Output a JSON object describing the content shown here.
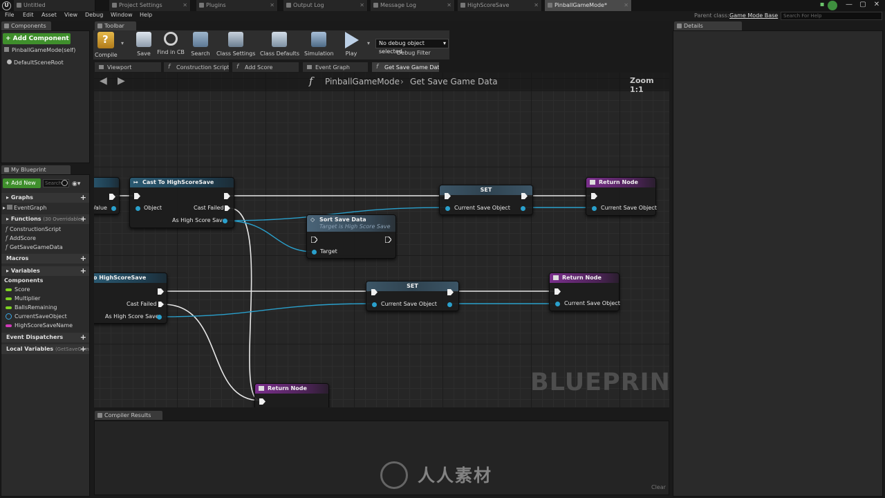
{
  "doc_tabs": [
    {
      "label": "Untitled",
      "active": false
    },
    {
      "label": "Project Settings",
      "active": false
    },
    {
      "label": "Plugins",
      "active": false
    },
    {
      "label": "Output Log",
      "active": false
    },
    {
      "label": "Message Log",
      "active": false
    },
    {
      "label": "HighScoreSave",
      "active": false
    },
    {
      "label": "PinballGameMode*",
      "active": true
    }
  ],
  "menu": [
    "File",
    "Edit",
    "Asset",
    "View",
    "Debug",
    "Window",
    "Help"
  ],
  "parent_class": {
    "label": "Parent class:",
    "value": "Game Mode Base"
  },
  "help_search_placeholder": "Search For Help",
  "components_panel": {
    "tab": "Components",
    "add_button": "+ Add Component",
    "items": [
      "PinballGameMode(self)",
      "DefaultSceneRoot"
    ]
  },
  "toolbar": {
    "tab": "Toolbar",
    "buttons": [
      "Compile",
      "Save",
      "Find in CB",
      "Search",
      "Class Settings",
      "Class Defaults",
      "Simulation",
      "Play"
    ],
    "debug_select": "No debug object selected",
    "debug_filter_label": "Debug Filter"
  },
  "editor_tabs": [
    "Viewport",
    "Construction Script",
    "Add Score",
    "Event Graph",
    "Get Save Game Dat"
  ],
  "graph": {
    "breadcrumb_root": "PinballGameMode",
    "breadcrumb_func": "Get Save Game Data",
    "zoom": "Zoom 1:1",
    "watermark": "BLUEPRINT"
  },
  "nodes": {
    "partial_top": {
      "pin_label": "Value"
    },
    "cast_top": {
      "title": "Cast To HighScoreSave",
      "pins": [
        "Object",
        "Cast Failed",
        "As High Score Save"
      ]
    },
    "sort_save": {
      "title": "Sort Save Data",
      "subtitle": "Target is High Score Save",
      "pins": [
        "Target"
      ]
    },
    "set_top": {
      "title": "SET",
      "pins": [
        "Current Save Object"
      ]
    },
    "return_top": {
      "title": "Return Node",
      "pins": [
        "Current Save Object"
      ]
    },
    "cast_bottom": {
      "title": "o HighScoreSave",
      "pins": [
        "Cast Failed",
        "As High Score Save"
      ]
    },
    "set_bottom": {
      "title": "SET",
      "pins": [
        "Current Save Object"
      ]
    },
    "return_mid": {
      "title": "Return Node",
      "pins": [
        "Current Save Object"
      ]
    },
    "return_bottom": {
      "title": "Return Node"
    }
  },
  "my_blueprint": {
    "tab": "My Blueprint",
    "add_new": "+ Add New",
    "search_placeholder": "Search",
    "sections": {
      "graphs": "Graphs",
      "functions": "Functions",
      "functions_note": "(30 Overridable)",
      "macros": "Macros",
      "variables": "Variables",
      "components": "Components",
      "event_dispatchers": "Event Dispatchers",
      "local_variables": "Local Variables",
      "local_variables_note": "(GetSaveGam"
    },
    "graphs": [
      "EventGraph"
    ],
    "functions": [
      "ConstructionScript",
      "AddScore",
      "GetSaveGameData"
    ],
    "variables": [
      {
        "name": "Score",
        "color": "#7ed321"
      },
      {
        "name": "Multiplier",
        "color": "#7ed321"
      },
      {
        "name": "BallsRemaining",
        "color": "#7ed321"
      },
      {
        "name": "CurrentSaveObject",
        "color": "#3aa8e8"
      },
      {
        "name": "HighScoreSaveName",
        "color": "#d03ab8"
      }
    ]
  },
  "compiler_results": {
    "tab": "Compiler Results",
    "clear": "Clear"
  },
  "details": {
    "tab": "Details"
  },
  "site_watermark": "人人素材"
}
